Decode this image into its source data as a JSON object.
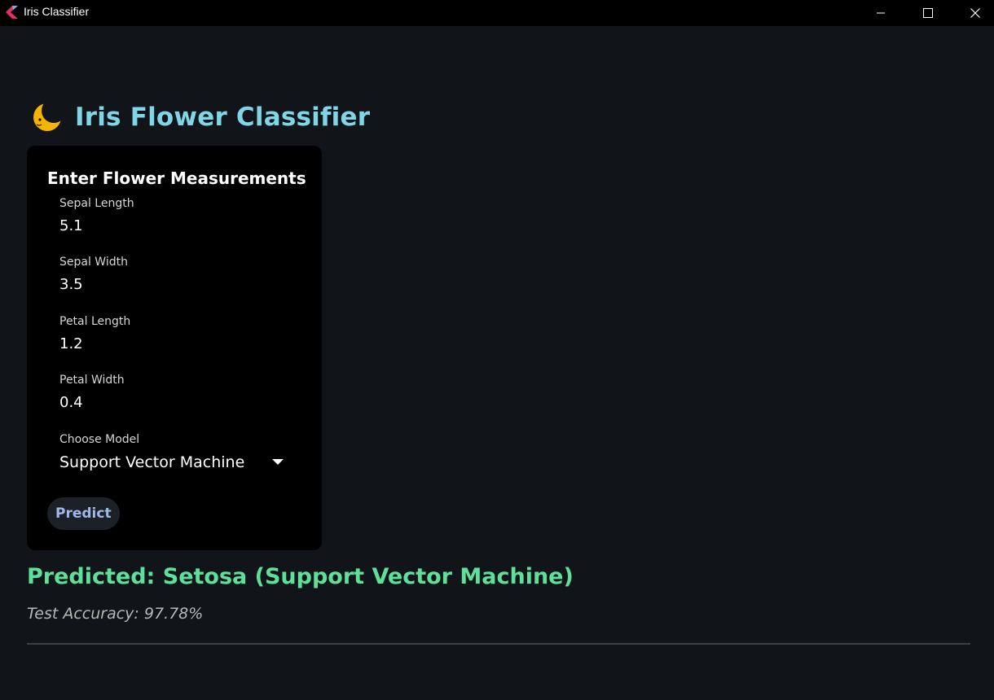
{
  "window": {
    "title": "Iris Classifier",
    "controls": [
      "minimize",
      "maximize",
      "close"
    ]
  },
  "header": {
    "icon": "crescent-moon-icon",
    "title": "Iris Flower Classifier"
  },
  "form": {
    "title": "Enter Flower Measurements",
    "fields": [
      {
        "label": "Sepal Length",
        "value": "5.1"
      },
      {
        "label": "Sepal Width",
        "value": "3.5"
      },
      {
        "label": "Petal Length",
        "value": "1.2"
      },
      {
        "label": "Petal Width",
        "value": "0.4"
      }
    ],
    "model": {
      "label": "Choose Model",
      "selected": "Support Vector Machine"
    },
    "predict_label": "Predict"
  },
  "result": {
    "prediction": "Predicted: Setosa (Support Vector Machine)",
    "accuracy": "Test Accuracy: 97.78%"
  },
  "colors": {
    "background": "#111418",
    "card": "#000000",
    "title": "#7fd6e6",
    "prediction": "#5ee09a",
    "button_text": "#9fb8e8"
  }
}
